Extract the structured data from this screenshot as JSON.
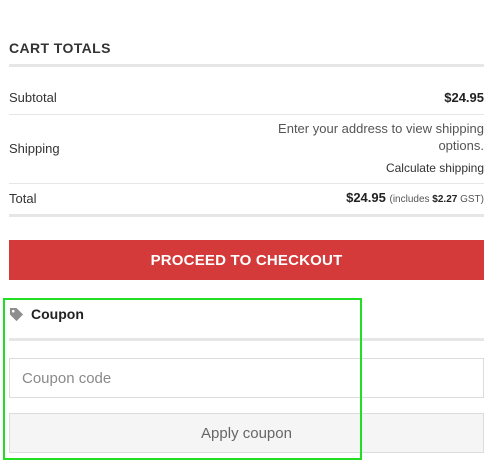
{
  "cart_totals": {
    "title": "CART TOTALS",
    "subtotal_label": "Subtotal",
    "subtotal_value": "$24.95",
    "shipping_label": "Shipping",
    "shipping_note": "Enter your address to view shipping options.",
    "calculate_shipping_link": "Calculate shipping",
    "total_label": "Total",
    "total_value": "$24.95",
    "tax_prefix": "(includes",
    "tax_value": "$2.27",
    "tax_suffix": "GST)"
  },
  "checkout": {
    "button_label": "PROCEED TO CHECKOUT",
    "button_color": "#d53a3a"
  },
  "coupon": {
    "heading": "Coupon",
    "heading_icon": "tag-icon",
    "input_placeholder": "Coupon code",
    "input_value": "",
    "apply_button_label": "Apply coupon",
    "highlight_color": "#22dd22"
  }
}
